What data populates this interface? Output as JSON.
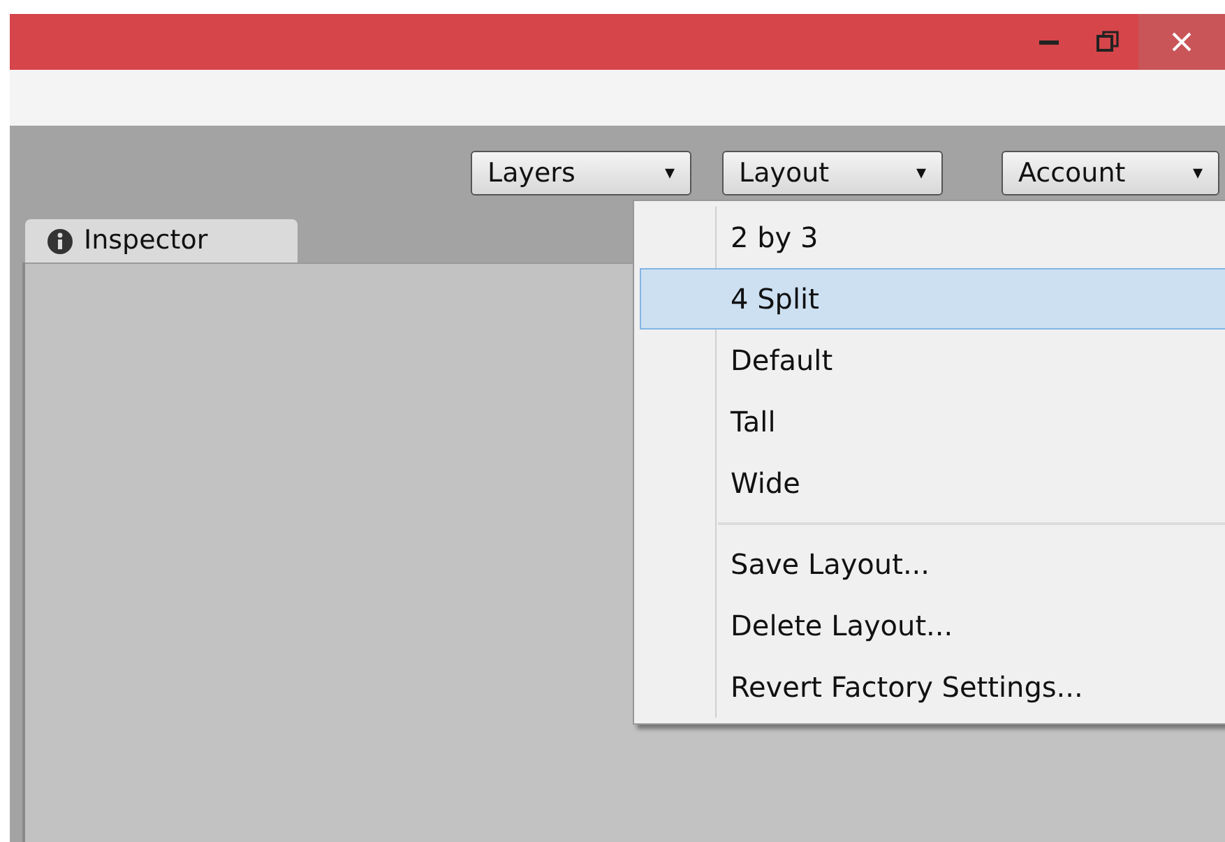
{
  "toolbar": {
    "buttons": [
      {
        "label": "Layers",
        "arrow": "▾"
      },
      {
        "label": "Layout",
        "arrow": "▾"
      },
      {
        "label": "Account",
        "arrow": "▾"
      }
    ]
  },
  "tab": {
    "label": "Inspector",
    "selected": true
  },
  "menu": {
    "groups": [
      [
        {
          "label": "2 by 3",
          "selected": false
        },
        {
          "label": "4 Split",
          "selected": true
        },
        {
          "label": "Default",
          "selected": false
        },
        {
          "label": "Tall",
          "selected": false
        },
        {
          "label": "Wide",
          "selected": false
        }
      ],
      [
        {
          "label": "Save Layout...",
          "selected": false
        },
        {
          "label": "Delete Layout...",
          "selected": false
        },
        {
          "label": "Revert Factory Settings...",
          "selected": false
        }
      ]
    ]
  }
}
